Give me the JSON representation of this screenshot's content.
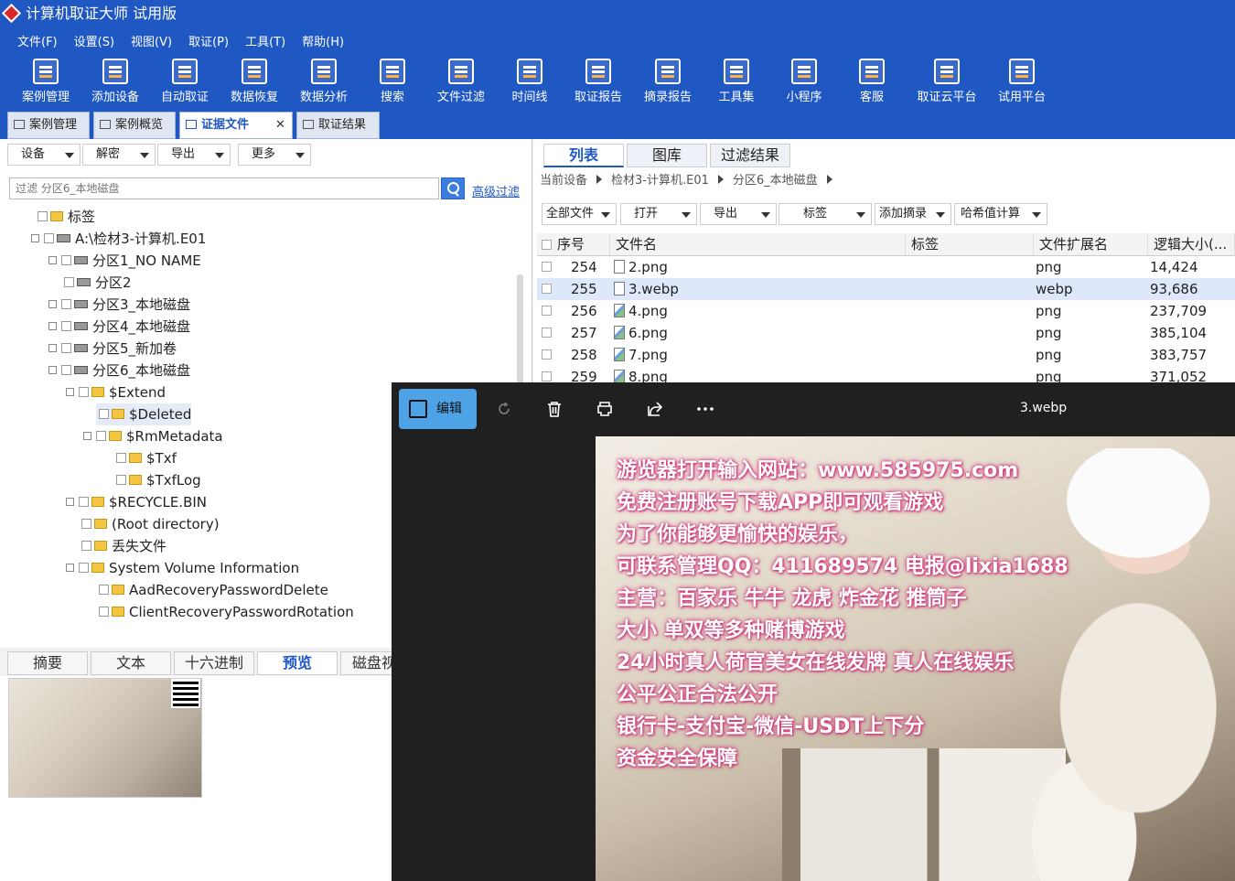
{
  "app": {
    "title": "计算机取证大师 试用版"
  },
  "menu": [
    "文件(F)",
    "设置(S)",
    "视图(V)",
    "取证(P)",
    "工具(T)",
    "帮助(H)"
  ],
  "ribbon": [
    "案例管理",
    "添加设备",
    "自动取证",
    "数据恢复",
    "数据分析",
    "搜索",
    "文件过滤",
    "时间线",
    "取证报告",
    "摘录报告",
    "工具集",
    "小程序",
    "客服",
    "取证云平台",
    "试用平台"
  ],
  "doc_tabs": [
    "案例管理",
    "案例概览",
    "证据文件",
    "取证结果"
  ],
  "left_toolbar": [
    "设备",
    "解密",
    "导出",
    "更多"
  ],
  "filter": {
    "placeholder": "过滤 分区6_本地磁盘",
    "advanced": "高级过滤"
  },
  "tree": [
    "标签",
    "A:\\检材3-计算机.E01",
    "分区1_NO NAME",
    "分区2",
    "分区3_本地磁盘",
    "分区4_本地磁盘",
    "分区5_新加卷",
    "分区6_本地磁盘",
    "$Extend",
    "$Deleted",
    "$RmMetadata",
    "$Txf",
    "$TxfLog",
    "$RECYCLE.BIN",
    "(Root directory)",
    "丢失文件",
    "System Volume Information",
    "AadRecoveryPasswordDelete",
    "ClientRecoveryPasswordRotation"
  ],
  "bottom_tabs": [
    "摘要",
    "文本",
    "十六进制",
    "预览",
    "磁盘视"
  ],
  "right_tabs": [
    "列表",
    "图库",
    "过滤结果"
  ],
  "path": [
    "当前设备",
    "检材3-计算机.E01",
    "分区6_本地磁盘"
  ],
  "right_toolbar": [
    "全部文件",
    "打开",
    "导出",
    "标签",
    "添加摘录",
    "哈希值计算"
  ],
  "grid": {
    "headers": [
      "序号",
      "文件名",
      "标签",
      "文件扩展名",
      "逻辑大小(..."
    ],
    "rows": [
      {
        "no": "254",
        "name": "2.png",
        "ext": "png",
        "size": "14,424"
      },
      {
        "no": "255",
        "name": "3.webp",
        "ext": "webp",
        "size": "93,686"
      },
      {
        "no": "256",
        "name": "4.png",
        "ext": "png",
        "size": "237,709"
      },
      {
        "no": "257",
        "name": "6.png",
        "ext": "png",
        "size": "385,104"
      },
      {
        "no": "258",
        "name": "7.png",
        "ext": "png",
        "size": "383,757"
      },
      {
        "no": "259",
        "name": "8.png",
        "ext": "png",
        "size": "371,052"
      }
    ]
  },
  "viewer": {
    "edit_label": "编辑",
    "title": "3.webp",
    "ad_lines": [
      "游览器打开输入网站：www.585975.com",
      "免费注册账号下载APP即可观看游戏",
      "为了你能够更愉快的娱乐，",
      "可联系管理QQ：411689574 电报@lixia1688",
      "主营：百家乐 牛牛 龙虎 炸金花 推筒子",
      "大小 单双等多种赌博游戏",
      "24小时真人荷官美女在线发牌 真人在线娱乐",
      "公平公正合法公开",
      "银行卡-支付宝-微信-USDT上下分",
      "资金安全保障"
    ]
  }
}
